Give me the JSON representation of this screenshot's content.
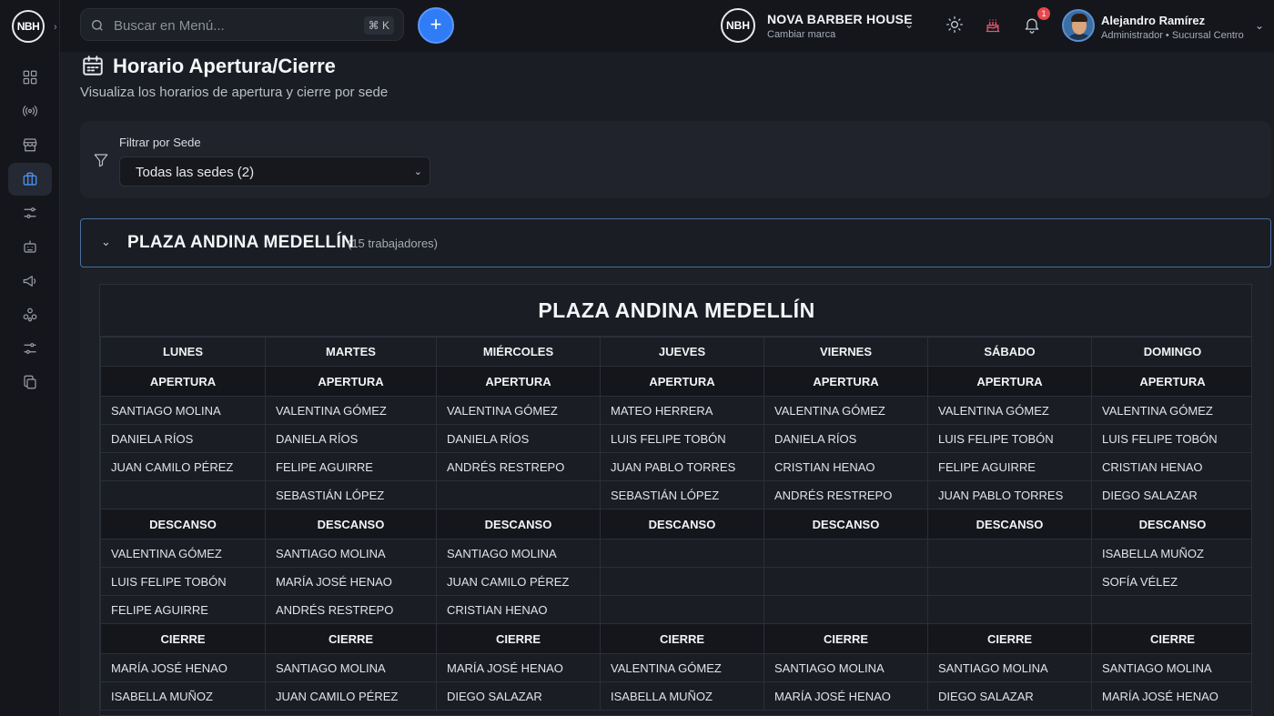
{
  "sidebar": {
    "logo": "NBH",
    "nav": [
      {
        "name": "dashboard-icon",
        "active": false
      },
      {
        "name": "broadcast-icon",
        "active": false
      },
      {
        "name": "store-icon",
        "active": false
      },
      {
        "name": "briefcase-icon",
        "active": true
      },
      {
        "name": "sliders-icon",
        "active": false
      },
      {
        "name": "robot-icon",
        "active": false
      },
      {
        "name": "megaphone-icon",
        "active": false
      },
      {
        "name": "network-icon",
        "active": false
      },
      {
        "name": "settings-icon",
        "active": false
      },
      {
        "name": "copy-icon",
        "active": false
      }
    ]
  },
  "topbar": {
    "search_placeholder": "Buscar en Menú...",
    "search_shortcut": "⌘ K",
    "add_label": "+",
    "brand_logo": "NBH",
    "brand_name": "NOVA BARBER HOUSE",
    "brand_sub": "Cambiar marca",
    "notification_count": "1",
    "user_name": "Alejandro Ramírez",
    "user_role": "Administrador • Sucursal Centro"
  },
  "page": {
    "title": "Horario Apertura/Cierre",
    "subtitle": "Visualiza los horarios de apertura y cierre por sede"
  },
  "filter": {
    "label": "Filtrar por Sede",
    "selected": "Todas las sedes (2)"
  },
  "sede": {
    "name": "PLAZA ANDINA MEDELLÍN",
    "count": "(15 trabajadores)",
    "table_title": "PLAZA ANDINA MEDELLÍN",
    "days": [
      "LUNES",
      "MARTES",
      "MIÉRCOLES",
      "JUEVES",
      "VIERNES",
      "SÁBADO",
      "DOMINGO"
    ],
    "sections": [
      {
        "label": "APERTURA",
        "rows": [
          [
            "SANTIAGO MOLINA",
            "VALENTINA GÓMEZ",
            "VALENTINA GÓMEZ",
            "MATEO HERRERA",
            "VALENTINA GÓMEZ",
            "VALENTINA GÓMEZ",
            "VALENTINA GÓMEZ"
          ],
          [
            "DANIELA RÍOS",
            "DANIELA RÍOS",
            "DANIELA RÍOS",
            "LUIS FELIPE TOBÓN",
            "DANIELA RÍOS",
            "LUIS FELIPE TOBÓN",
            "LUIS FELIPE TOBÓN"
          ],
          [
            "JUAN CAMILO PÉREZ",
            "FELIPE AGUIRRE",
            "ANDRÉS RESTREPO",
            "JUAN PABLO TORRES",
            "CRISTIAN HENAO",
            "FELIPE AGUIRRE",
            "CRISTIAN HENAO"
          ],
          [
            "",
            "SEBASTIÁN LÓPEZ",
            "",
            "SEBASTIÁN LÓPEZ",
            "ANDRÉS RESTREPO",
            "JUAN PABLO TORRES",
            "DIEGO SALAZAR"
          ]
        ]
      },
      {
        "label": "DESCANSO",
        "rows": [
          [
            "VALENTINA GÓMEZ",
            "SANTIAGO MOLINA",
            "SANTIAGO MOLINA",
            "",
            "",
            "",
            "ISABELLA MUÑOZ"
          ],
          [
            "LUIS FELIPE TOBÓN",
            "MARÍA JOSÉ HENAO",
            "JUAN CAMILO PÉREZ",
            "",
            "",
            "",
            "SOFÍA VÉLEZ"
          ],
          [
            "FELIPE AGUIRRE",
            "ANDRÉS RESTREPO",
            "CRISTIAN HENAO",
            "",
            "",
            "",
            ""
          ]
        ]
      },
      {
        "label": "CIERRE",
        "rows": [
          [
            "MARÍA JOSÉ HENAO",
            "SANTIAGO MOLINA",
            "MARÍA JOSÉ HENAO",
            "VALENTINA GÓMEZ",
            "SANTIAGO MOLINA",
            "SANTIAGO MOLINA",
            "SANTIAGO MOLINA"
          ],
          [
            "ISABELLA MUÑOZ",
            "JUAN CAMILO PÉREZ",
            "DIEGO SALAZAR",
            "ISABELLA MUÑOZ",
            "MARÍA JOSÉ HENAO",
            "DIEGO SALAZAR",
            "MARÍA JOSÉ HENAO"
          ]
        ]
      }
    ]
  },
  "colors": {
    "accent": "#2f7cf6",
    "background": "#1a1d24",
    "sidebar": "#14161c",
    "badge": "#e5484d"
  }
}
